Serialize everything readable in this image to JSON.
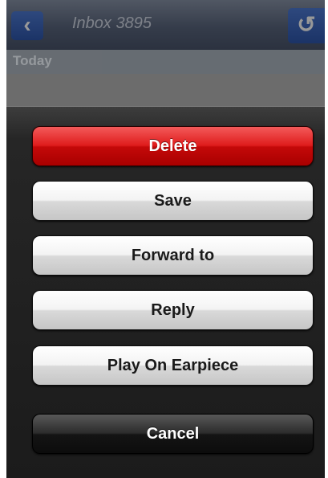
{
  "navbar": {
    "back_icon": "chevron-left-icon",
    "back_glyph": "‹",
    "title": "Inbox 3895",
    "refresh_icon": "refresh-icon",
    "refresh_glyph": "↺"
  },
  "list": {
    "section_title": "Today"
  },
  "action_sheet": {
    "delete_label": "Delete",
    "save_label": "Save",
    "forward_label": "Forward to",
    "reply_label": "Reply",
    "earpiece_label": "Play On Earpiece",
    "cancel_label": "Cancel"
  },
  "colors": {
    "delete": "#df1c1c",
    "nav_button": "#2a5bc0",
    "sheet_background": "#262626"
  }
}
